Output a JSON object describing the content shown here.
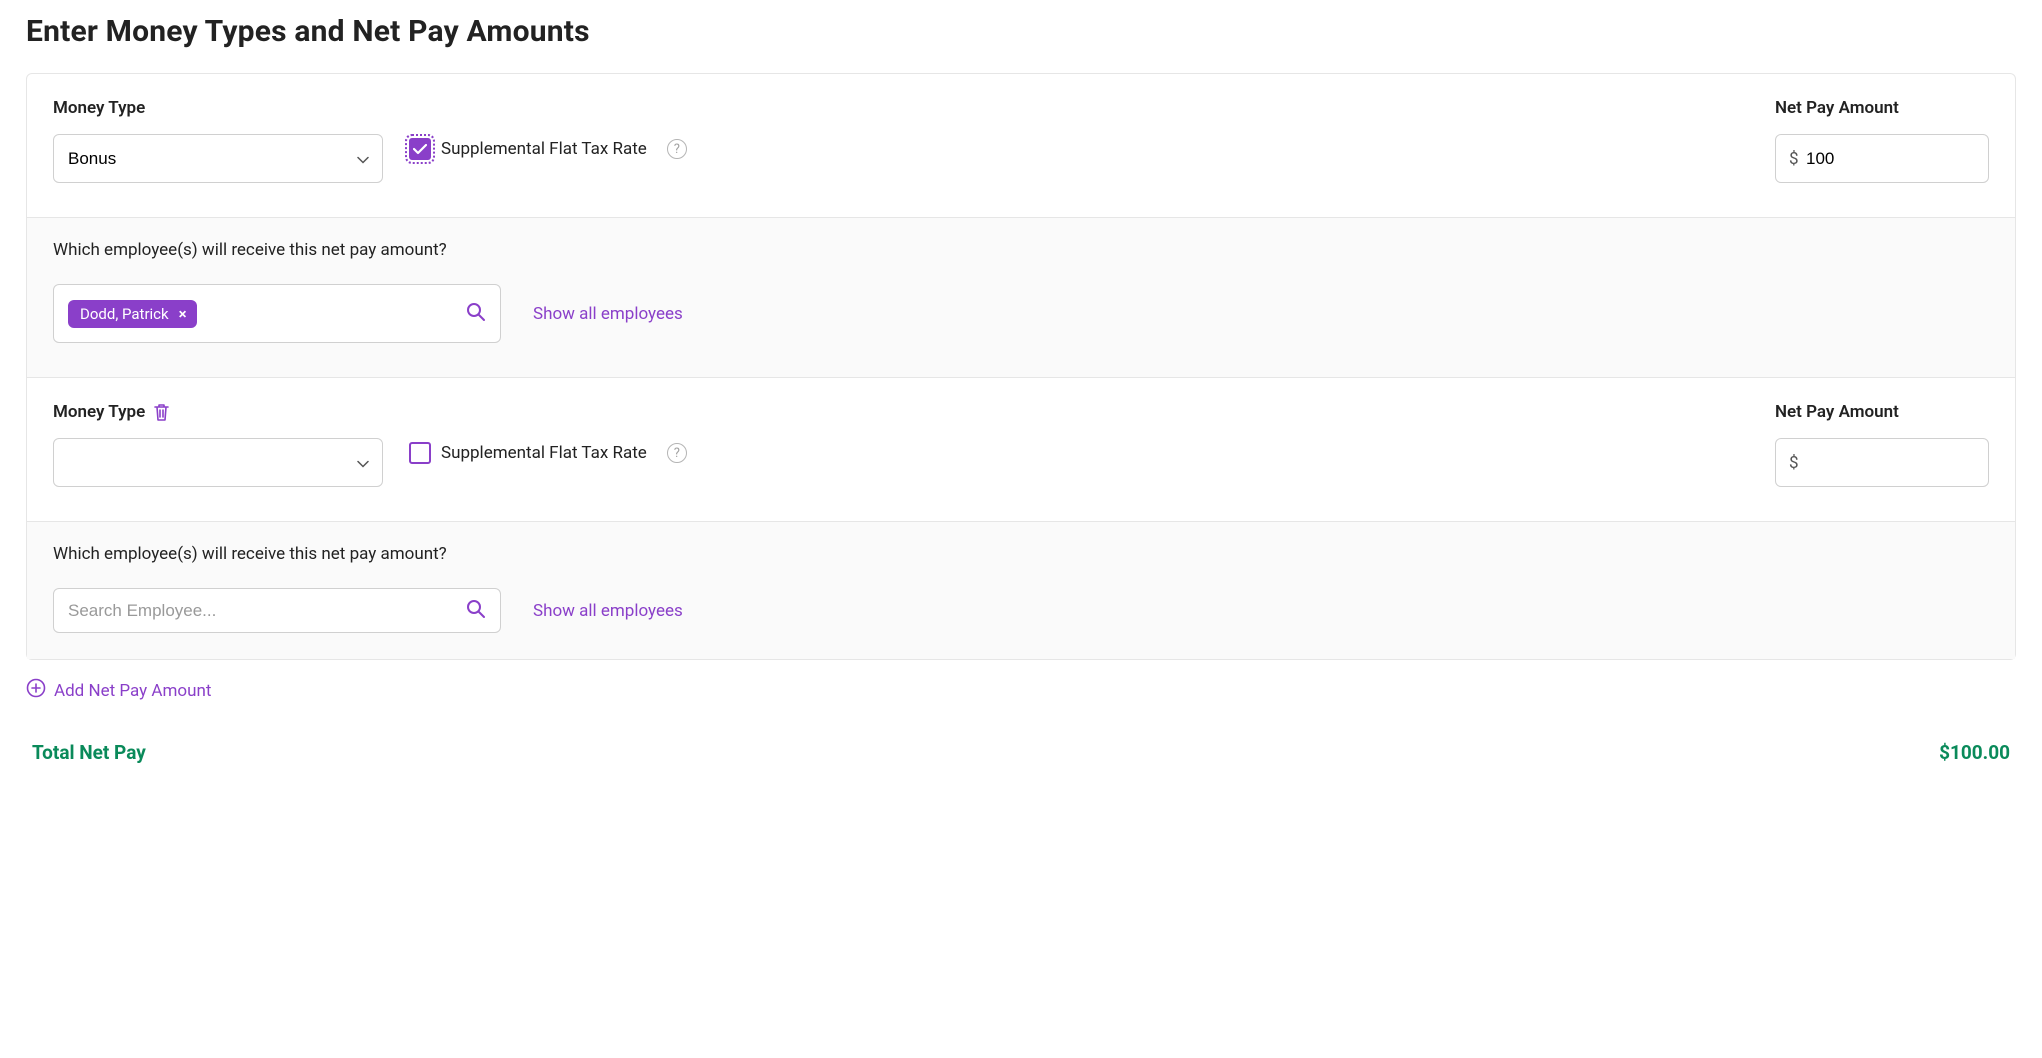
{
  "page": {
    "title": "Enter Money Types and Net Pay Amounts"
  },
  "labels": {
    "money_type": "Money Type",
    "net_pay_amount": "Net Pay Amount",
    "supplemental_flat_tax_rate": "Supplemental Flat Tax Rate",
    "employee_question": "Which employee(s) will receive this net pay amount?",
    "show_all_employees": "Show all employees",
    "search_placeholder": "Search Employee...",
    "add_net_pay_amount": "Add Net Pay Amount",
    "total_net_pay": "Total Net Pay",
    "currency_prefix": "$"
  },
  "rows": [
    {
      "money_type_value": "Bonus",
      "supplemental_checked": true,
      "net_pay_value": "100",
      "deletable": false,
      "employee_tag": "Dodd, Patrick",
      "has_tag": true
    },
    {
      "money_type_value": "",
      "supplemental_checked": false,
      "net_pay_value": "",
      "deletable": true,
      "employee_tag": "",
      "has_tag": false
    }
  ],
  "totals": {
    "amount": "$100.00"
  },
  "colors": {
    "accent_purple": "#8a3fc9",
    "accent_green": "#0a8a5a"
  }
}
